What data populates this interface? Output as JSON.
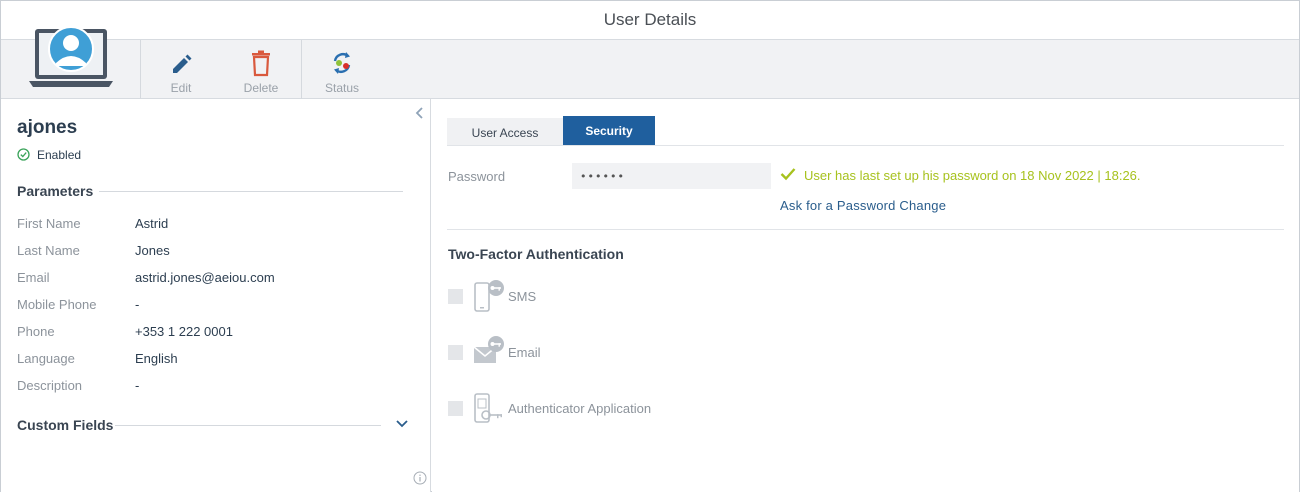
{
  "window": {
    "title": "User Details"
  },
  "toolbar": {
    "edit_label": "Edit",
    "delete_label": "Delete",
    "status_label": "Status"
  },
  "user": {
    "username": "ajones",
    "status": "Enabled"
  },
  "parameters": {
    "heading": "Parameters",
    "fields": [
      {
        "label": "First Name",
        "value": "Astrid"
      },
      {
        "label": "Last Name",
        "value": "Jones"
      },
      {
        "label": "Email",
        "value": "astrid.jones@aeiou.com"
      },
      {
        "label": "Mobile Phone",
        "value": "-"
      },
      {
        "label": "Phone",
        "value": "+353 1 222 0001"
      },
      {
        "label": "Language",
        "value": "English"
      },
      {
        "label": "Description",
        "value": "-"
      }
    ]
  },
  "custom_fields": {
    "heading": "Custom Fields"
  },
  "tabs": [
    {
      "label": "User Access",
      "active": false
    },
    {
      "label": "Security",
      "active": true
    }
  ],
  "security": {
    "password_label": "Password",
    "password_value": "••••••",
    "password_message": "User has last set up his password on 18 Nov 2022 | 18:26.",
    "password_change_link": "Ask for a Password Change",
    "tfa_heading": "Two-Factor Authentication",
    "tfa_options": [
      {
        "label": "SMS",
        "icon": "phone-key-icon",
        "checked": false
      },
      {
        "label": "Email",
        "icon": "envelope-key-icon",
        "checked": false
      },
      {
        "label": "Authenticator Application",
        "icon": "authenticator-app-icon",
        "checked": false
      }
    ]
  },
  "colors": {
    "accent": "#1f5f9e",
    "edit_icon": "#2a5d8c",
    "delete_icon": "#d9593d",
    "success_message": "#a7c21e"
  }
}
